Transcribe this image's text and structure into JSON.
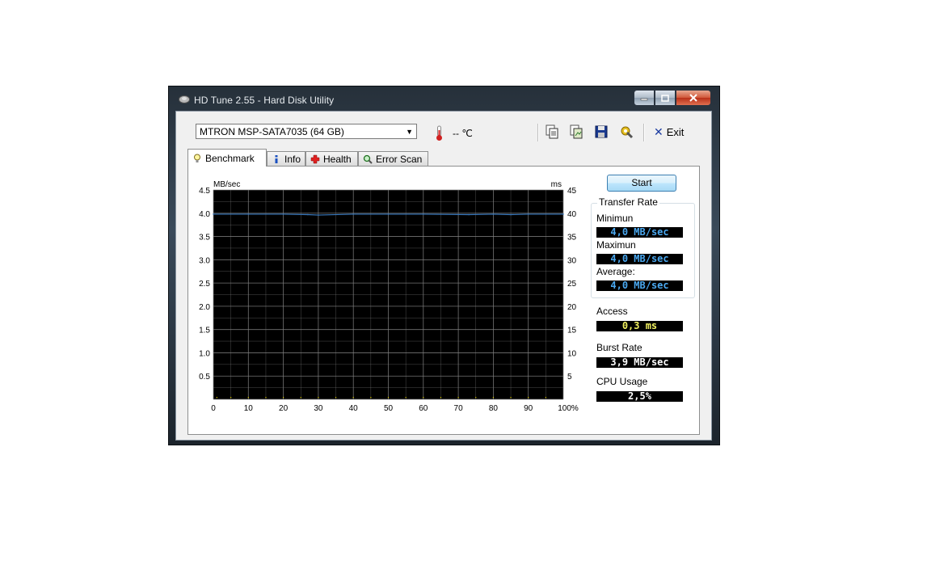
{
  "window": {
    "title": "HD Tune 2.55 - Hard Disk Utility"
  },
  "toolbar": {
    "drive": "MTRON MSP-SATA7035 (64 GB)",
    "temperature": "-- ℃",
    "exit_label": "Exit"
  },
  "tabs": [
    {
      "label": "Benchmark",
      "icon": "lightbulb-icon",
      "active": true
    },
    {
      "label": "Info",
      "icon": "info-icon",
      "active": false
    },
    {
      "label": "Health",
      "icon": "health-cross-icon",
      "active": false
    },
    {
      "label": "Error Scan",
      "icon": "magnifier-icon",
      "active": false
    }
  ],
  "benchmark": {
    "start_label": "Start",
    "transfer_rate_title": "Transfer Rate",
    "minimum_label": "Minimun",
    "minimum_value": "4,0 MB/sec",
    "maximum_label": "Maximun",
    "maximum_value": "4,0 MB/sec",
    "average_label": "Average:",
    "average_value": "4,0 MB/sec",
    "access_label": "Access",
    "access_value": "0,3 ms",
    "burst_label": "Burst Rate",
    "burst_value": "3,9 MB/sec",
    "cpu_label": "CPU Usage",
    "cpu_value": "2,5%"
  },
  "colors": {
    "transfer_line": "#3a7abf",
    "access_dots": "#e8d400",
    "grid": "#808080",
    "plot_bg": "#000000"
  },
  "chart_data": {
    "type": "line",
    "xlabel": "",
    "ylabel": "MB/sec",
    "y2label": "ms",
    "x_ticks": [
      "0",
      "10",
      "20",
      "30",
      "40",
      "50",
      "60",
      "70",
      "80",
      "90",
      "100%"
    ],
    "y_ticks": [
      "0.5",
      "1.0",
      "1.5",
      "2.0",
      "2.5",
      "3.0",
      "3.5",
      "4.0",
      "4.5"
    ],
    "y2_ticks": [
      "5",
      "10",
      "15",
      "20",
      "25",
      "30",
      "35",
      "40",
      "45"
    ],
    "xlim": [
      0,
      100
    ],
    "ylim": [
      0,
      4.5
    ],
    "y2lim": [
      0,
      45
    ],
    "grid": true,
    "series": [
      {
        "axis": "left",
        "x": [
          0,
          10,
          20,
          27,
          30,
          40,
          50,
          60,
          73,
          80,
          85,
          90,
          100
        ],
        "values": [
          3.98,
          3.98,
          3.98,
          3.97,
          3.96,
          3.98,
          3.98,
          3.98,
          3.97,
          3.98,
          3.97,
          3.98,
          3.98
        ]
      },
      {
        "axis": "right",
        "x": [
          1,
          5,
          10,
          15,
          20,
          25,
          30,
          35,
          40,
          45,
          50,
          55,
          60,
          65,
          70,
          75,
          80,
          85,
          90,
          95
        ],
        "values": [
          0.3,
          0.3,
          0.3,
          0.3,
          0.3,
          0.3,
          0.3,
          0.3,
          0.3,
          0.3,
          0.3,
          0.3,
          0.3,
          0.3,
          0.3,
          0.3,
          0.3,
          0.3,
          0.3,
          0.3
        ]
      }
    ]
  }
}
